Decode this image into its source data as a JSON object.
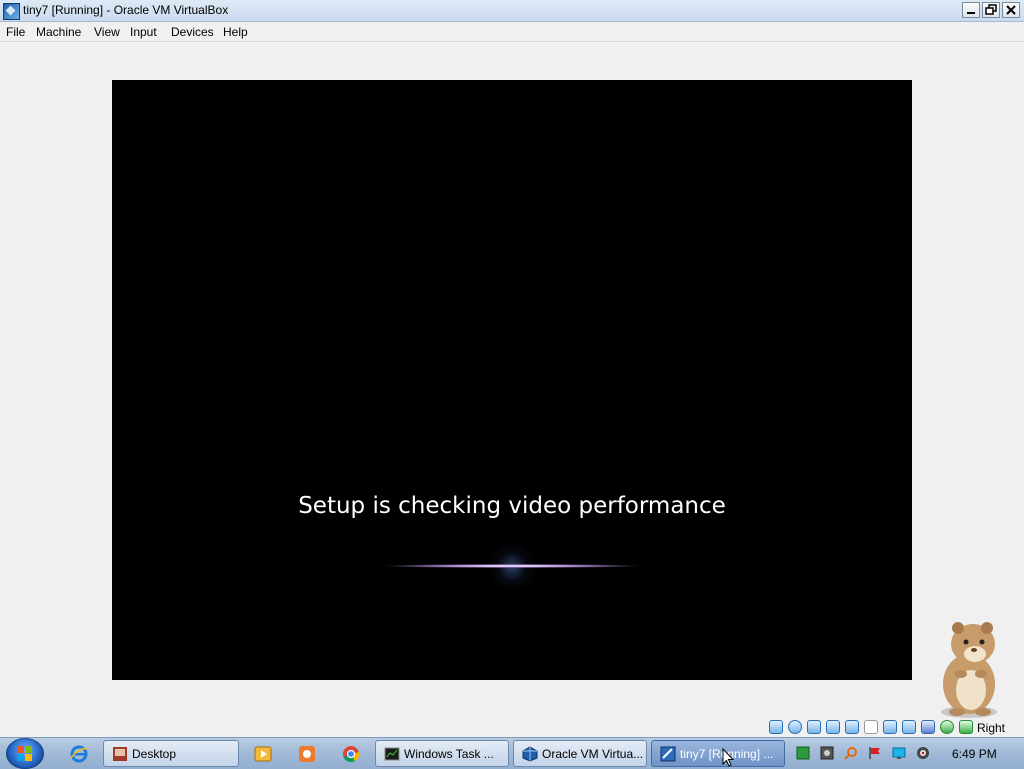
{
  "window": {
    "title": "tiny7 [Running] - Oracle VM VirtualBox",
    "controls": [
      "minimize",
      "restore",
      "close"
    ]
  },
  "menu": {
    "items": [
      "File",
      "Machine",
      "View",
      "Input",
      "Devices",
      "Help"
    ]
  },
  "vm": {
    "message": "Setup is checking video performance"
  },
  "statusbar": {
    "host_key": "Right Ctrl",
    "icons": [
      "hard-disk-icon",
      "optical-disk-icon",
      "usb-icon",
      "network-icon",
      "shared-folders-icon",
      "display-icon",
      "video-capture-icon",
      "network-adapter-icon",
      "virtualization-icon",
      "mouse-integration-icon",
      "download-icon"
    ]
  },
  "taskbar": {
    "start_label": "Start",
    "quick_launch": [
      "internet-explorer-icon",
      "media-player-icon",
      "app-icon",
      "chrome-icon"
    ],
    "buttons": [
      {
        "label": "Desktop",
        "icon": "desktop-icon"
      },
      {
        "label": "Windows Task ...",
        "icon": "task-manager-icon"
      },
      {
        "label": "Oracle VM Virtua...",
        "icon": "virtualbox-icon"
      },
      {
        "label": "tiny7 [Running] ...",
        "icon": "virtualbox-vm-icon"
      }
    ],
    "tray_icons": [
      "green-tray-icon",
      "settings-tray-icon",
      "search-tray-icon",
      "flag-tray-icon",
      "display-tray-icon",
      "volume-tray-icon"
    ],
    "clock": "6:49 PM"
  },
  "colors": {
    "vm_background": "#000000",
    "taskbar": "#a0b9d6",
    "active_button": "#6f93c6"
  }
}
